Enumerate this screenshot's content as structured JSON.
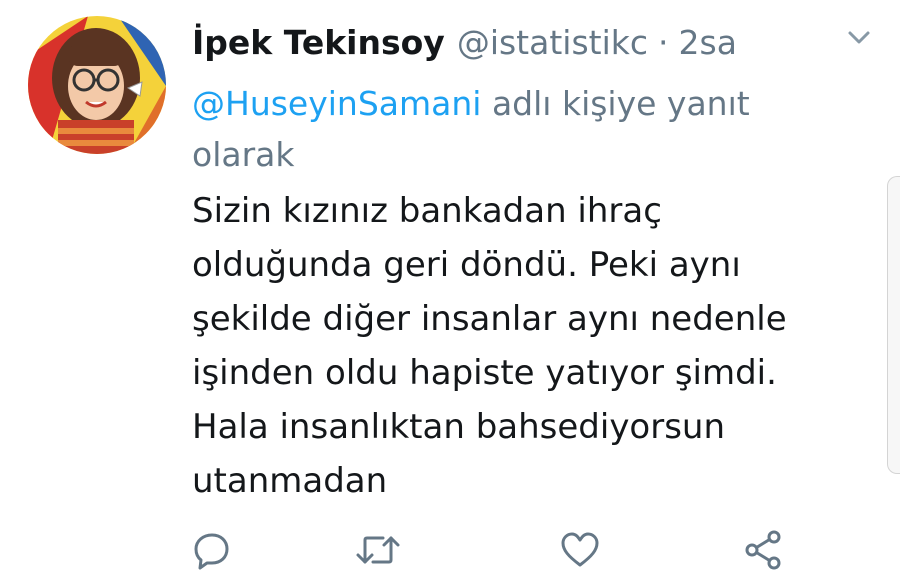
{
  "tweet": {
    "author_name": "İpek Tekinsoy",
    "handle": "@istatistikc",
    "separator": "·",
    "time": "2sa",
    "reply_mention": "@HuseyinSamani",
    "reply_suffix": " adlı kişiye yanıt olarak",
    "body_lines": [
      "Sizin kızınız bankadan ihraç",
      "olduğunda geri döndü. Peki aynı",
      "şekilde diğer insanlar aynı nedenle",
      "işinden oldu hapiste yatıyor şimdi.",
      "Hala insanlıktan bahsediyorsun",
      "utanmadan"
    ]
  },
  "icons": {
    "menu": "chevron-down-icon",
    "reply": "reply-bubble-icon",
    "retweet": "retweet-icon",
    "like": "heart-icon",
    "share": "share-icon"
  },
  "colors": {
    "text": "#14171a",
    "secondary": "#657786",
    "link": "#1da1f2",
    "icon": "#657786"
  }
}
